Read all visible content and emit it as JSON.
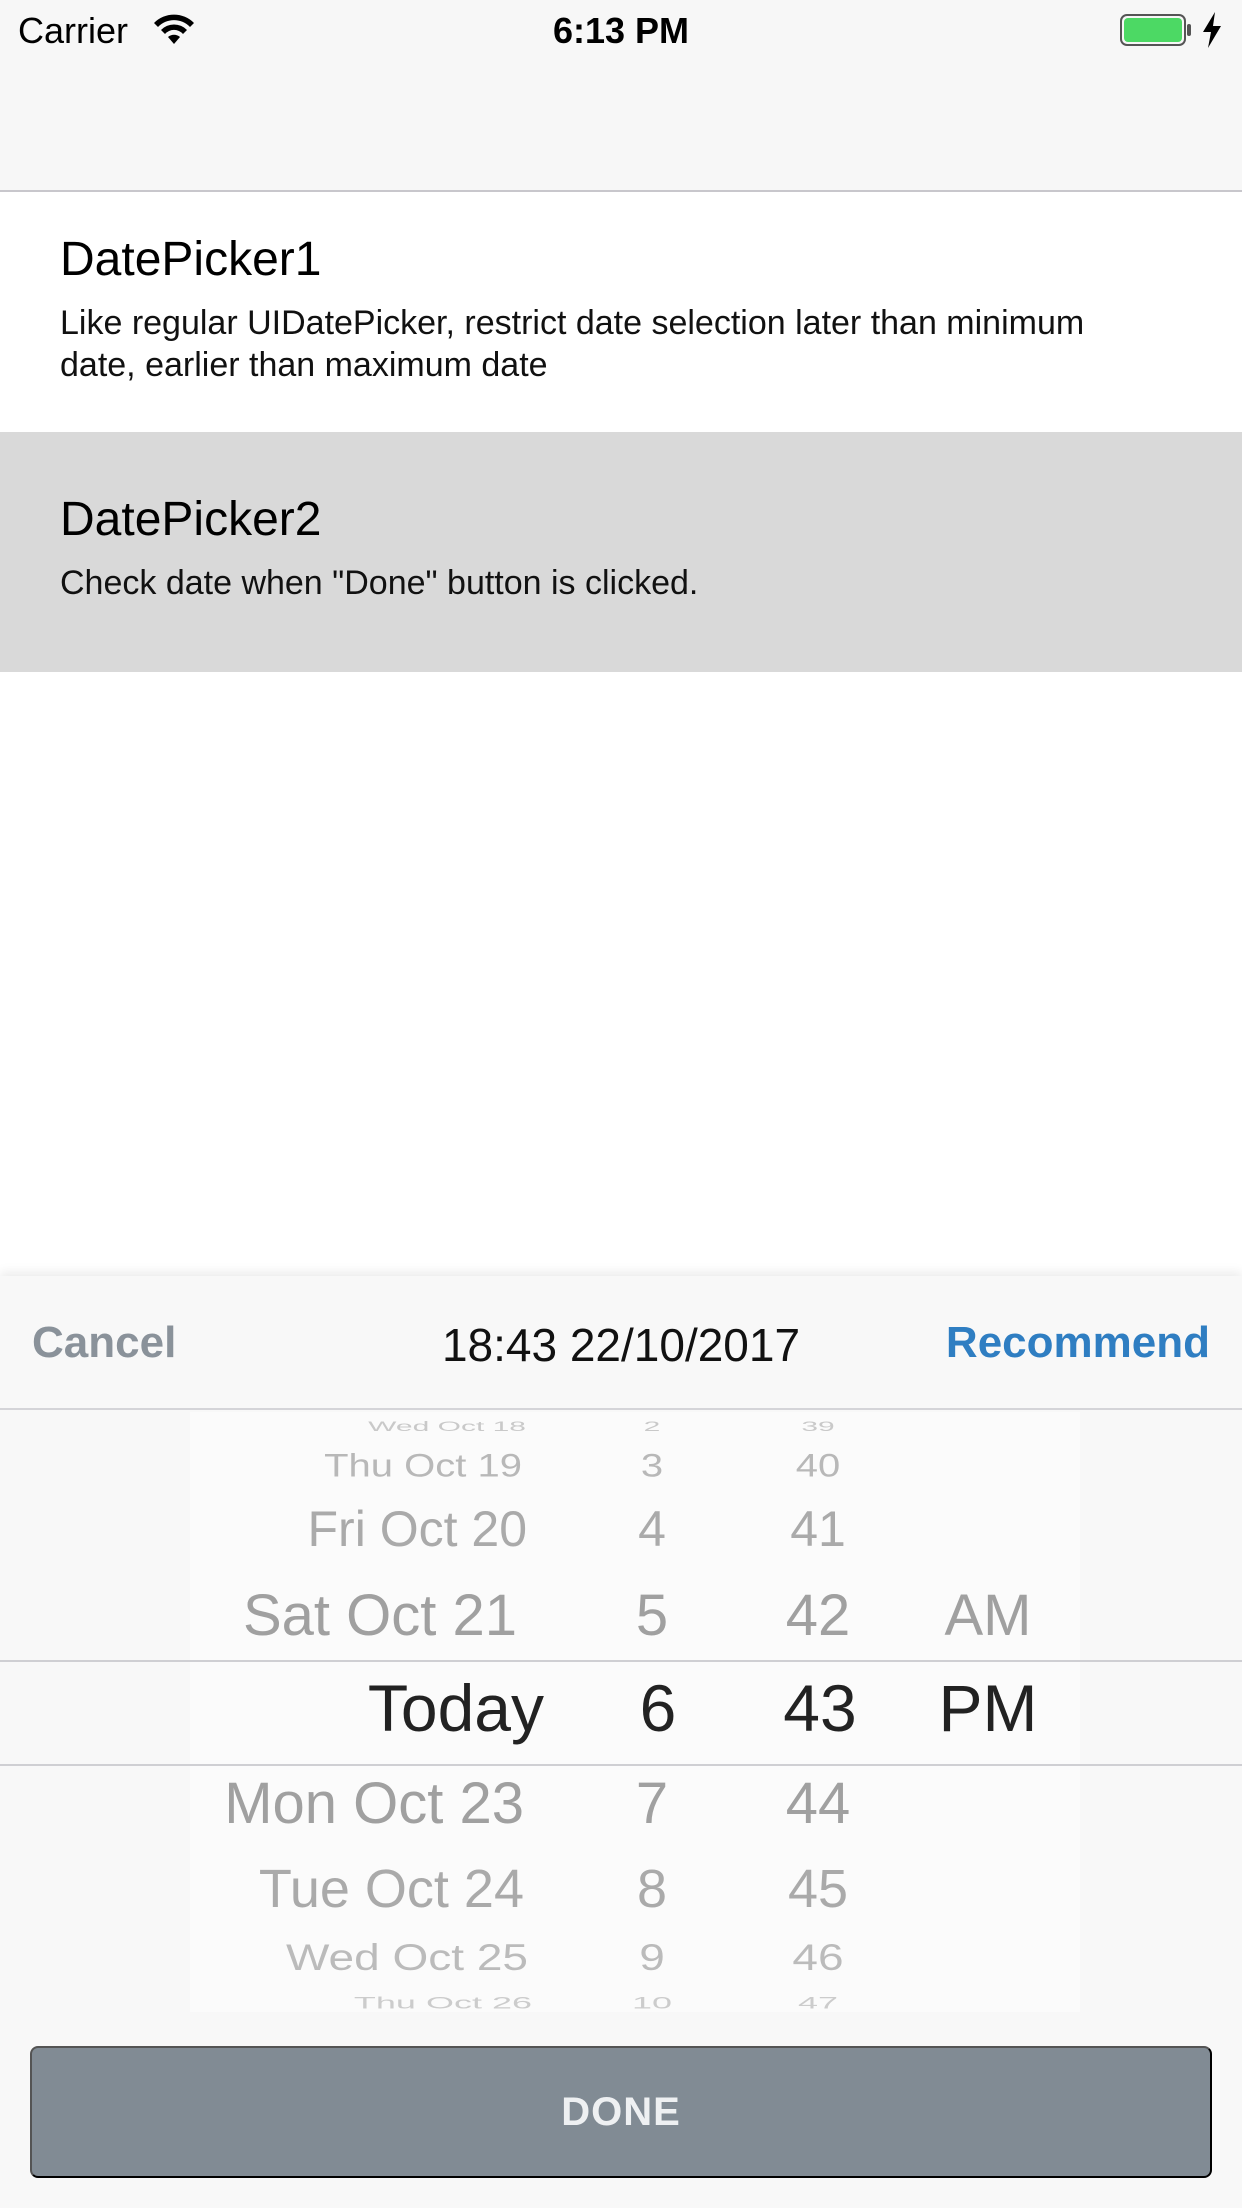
{
  "status_bar": {
    "carrier": "Carrier",
    "time": "6:13 PM"
  },
  "list": {
    "rows": [
      {
        "title": "DatePicker1",
        "subtitle": "Like regular UIDatePicker, restrict date selection later than minimum date, earlier than maximum date"
      },
      {
        "title": "DatePicker2",
        "subtitle": "Check date when \"Done\" button is clicked."
      }
    ]
  },
  "picker": {
    "cancel_label": "Cancel",
    "current_value": "18:43 22/10/2017",
    "recommend_label": "Recommend",
    "days": [
      "Wed Oct 18",
      "Thu Oct 19",
      "Fri Oct 20",
      "Sat Oct 21",
      "Today",
      "Mon Oct 23",
      "Tue Oct 24",
      "Wed Oct 25",
      "Thu Oct 26"
    ],
    "hours": [
      "2",
      "3",
      "4",
      "5",
      "6",
      "7",
      "8",
      "9",
      "10"
    ],
    "minutes": [
      "39",
      "40",
      "41",
      "42",
      "43",
      "44",
      "45",
      "46",
      "47"
    ],
    "periods": [
      "AM",
      "PM"
    ],
    "selected_day": "Today",
    "selected_hour": "6",
    "selected_minute": "43",
    "selected_period": "PM",
    "done_label": "DONE"
  },
  "colors": {
    "accent": "#2f7ec2",
    "cancel": "#8a929a",
    "done_button": "#818b94",
    "selected_row": "#d9d9d9",
    "battery": "#4cd964"
  }
}
